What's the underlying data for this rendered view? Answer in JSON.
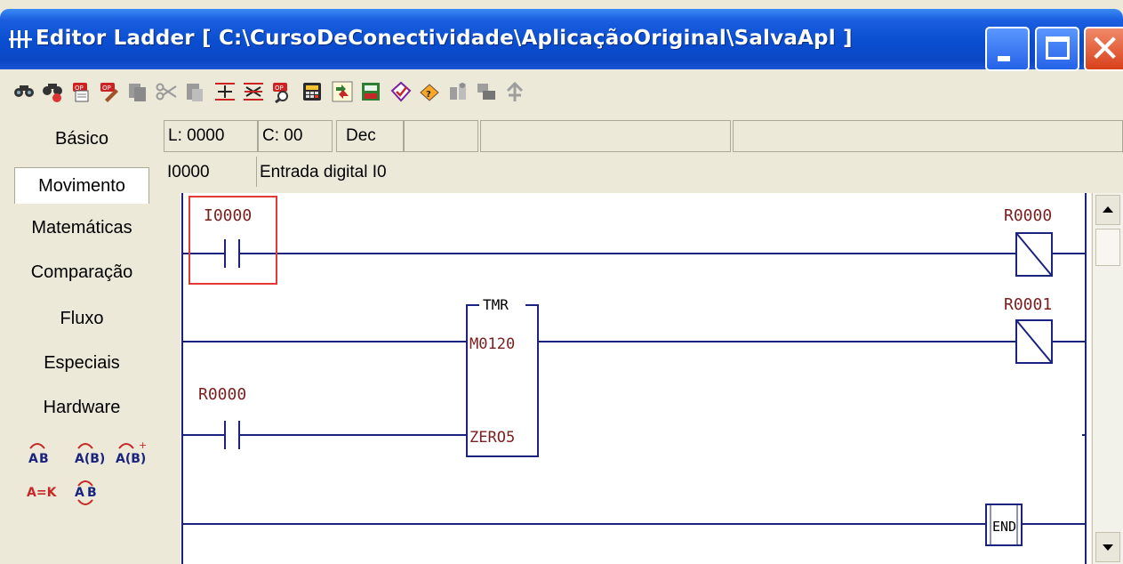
{
  "window": {
    "title": "Editor Ladder [ C:\\CursoDeConectividade\\AplicaçãoOriginal\\SalvaApl ]",
    "controls": {
      "minimize": "minimize",
      "maximize": "maximize",
      "close": "close"
    }
  },
  "toolbar": {
    "icons": [
      "find-icon",
      "find-next-icon",
      "operand-icon",
      "edit-operand-icon",
      "copy-disabled-icon",
      "cut-icon",
      "paste-disabled-icon",
      "insert-line-icon",
      "delete-line-icon",
      "operand-search-icon",
      "calculator-icon",
      "compile-icon",
      "save-to-plc-icon",
      "check-icon",
      "verify-icon",
      "transfer-icon",
      "send-disabled-icon",
      "tree-disabled-icon"
    ]
  },
  "status": {
    "line": "L: 0000",
    "column": "C: 00",
    "base": "Dec",
    "empty1": "",
    "empty2": "",
    "empty3": ""
  },
  "info": {
    "operand": "I0000",
    "description": "Entrada digital I0"
  },
  "sidebar": {
    "categories": [
      "Básico",
      "Movimento",
      "Matemáticas",
      "Comparação",
      "Fluxo",
      "Especiais",
      "Hardware"
    ],
    "active": "Movimento",
    "tools_row1": [
      "A B",
      "A(B)",
      "A(B)+"
    ],
    "tools_row2": [
      "A=K",
      "A B"
    ]
  },
  "ladder": {
    "rung1": {
      "contact": "I0000",
      "coil": "R0000"
    },
    "rung2": {
      "block": "TMR",
      "param1": "M0120",
      "param2": "ZERO5",
      "coil": "R0001"
    },
    "rung3": {
      "contact": "R0000"
    },
    "rung4": {
      "end": "END"
    }
  },
  "colors": {
    "title_bar": "#0a4ed0",
    "ladder_line": "#1a237e",
    "operand_text": "#7a1f1f",
    "selection": "#e03030"
  }
}
